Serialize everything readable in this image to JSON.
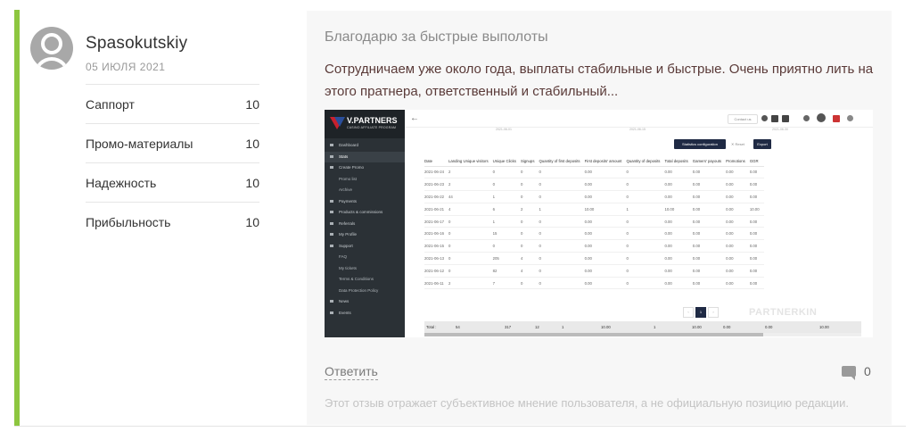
{
  "review": {
    "author": "Spasokutskiy",
    "date": "05 ИЮЛЯ 2021",
    "ratings": [
      {
        "label": "Саппорт",
        "value": "10"
      },
      {
        "label": "Промо-материалы",
        "value": "10"
      },
      {
        "label": "Надежность",
        "value": "10"
      },
      {
        "label": "Прибыльность",
        "value": "10"
      }
    ],
    "title": "Благодарю за быстрые выполоты",
    "body": "Сотрудничаем уже около года, выплаты стабильные и быстрые. Очень приятно лить на этого пратнера, ответственный и стабильный...",
    "reply_label": "Ответить",
    "comment_count": "0",
    "disclaimer": "Этот отзыв отражает субъективное мнение пользователя, а не официальную позицию редакции."
  },
  "screenshot": {
    "brand": "V.PARTNERS",
    "brand_sub": "CASINO AFFILIATE PROGRAM",
    "menu": [
      {
        "label": "Dashboard",
        "type": "item"
      },
      {
        "label": "Stats",
        "type": "active"
      },
      {
        "label": "Create Promo",
        "type": "item"
      },
      {
        "label": "Promo list",
        "type": "sub"
      },
      {
        "label": "Archive",
        "type": "sub"
      },
      {
        "label": "Payments",
        "type": "item"
      },
      {
        "label": "Products & commissions",
        "type": "item"
      },
      {
        "label": "Referrals",
        "type": "item"
      },
      {
        "label": "My Profile",
        "type": "item"
      },
      {
        "label": "Support",
        "type": "item"
      },
      {
        "label": "FAQ",
        "type": "sub"
      },
      {
        "label": "My tickets",
        "type": "sub"
      },
      {
        "label": "Terms & Conditions",
        "type": "sub"
      },
      {
        "label": "Data Protection Policy",
        "type": "sub"
      },
      {
        "label": "News",
        "type": "item"
      },
      {
        "label": "Events",
        "type": "item"
      }
    ],
    "back_glyph": "←",
    "contact_label": "Contact us",
    "stats_config_label": "Statistics configuration",
    "reset_label": "✕ Reset",
    "export_label": "Export",
    "range_dates": [
      "2021-06-01",
      "2021-06-15",
      "2021-06-30"
    ],
    "columns": [
      "Date",
      "Landing Unique visitors",
      "Unique Clicks",
      "Signups",
      "Quantity of first deposits",
      "First deposits' amount",
      "Quantity of deposits",
      "Total deposits",
      "Gamers' payouts",
      "Promotions",
      "GGR"
    ],
    "rows": [
      [
        "2021-06-24",
        "2",
        "0",
        "0",
        "0",
        "0.00",
        "0",
        "0.00",
        "0.00",
        "0.00",
        "0.00"
      ],
      [
        "2021-06-23",
        "2",
        "0",
        "0",
        "0",
        "0.00",
        "0",
        "0.00",
        "0.00",
        "0.00",
        "0.00"
      ],
      [
        "2021-06-22",
        "44",
        "1",
        "0",
        "0",
        "0.00",
        "0",
        "0.00",
        "0.00",
        "0.00",
        "0.00"
      ],
      [
        "2021-06-21",
        "4",
        "6",
        "2",
        "1",
        "10.00",
        "1",
        "10.00",
        "0.00",
        "0.00",
        "10.00"
      ],
      [
        "2021-06-17",
        "0",
        "1",
        "0",
        "0",
        "0.00",
        "0",
        "0.00",
        "0.00",
        "0.00",
        "0.00"
      ],
      [
        "2021-06-16",
        "0",
        "15",
        "0",
        "0",
        "0.00",
        "0",
        "0.00",
        "0.00",
        "0.00",
        "0.00"
      ],
      [
        "2021-06-15",
        "0",
        "0",
        "0",
        "0",
        "0.00",
        "0",
        "0.00",
        "0.00",
        "0.00",
        "0.00"
      ],
      [
        "2021-06-13",
        "0",
        "205",
        "4",
        "0",
        "0.00",
        "0",
        "0.00",
        "0.00",
        "0.00",
        "0.00"
      ],
      [
        "2021-06-12",
        "0",
        "82",
        "4",
        "0",
        "0.00",
        "0",
        "0.00",
        "0.00",
        "0.00",
        "0.00"
      ],
      [
        "2021-06-11",
        "2",
        "7",
        "0",
        "0",
        "0.00",
        "0",
        "0.00",
        "0.00",
        "0.00",
        "0.00"
      ]
    ],
    "pager": [
      "‹",
      "1",
      "›"
    ],
    "watermark": "PARTNERKIN",
    "totals": [
      "Total :",
      "54",
      "317",
      "12",
      "1",
      "10.00",
      "1",
      "10.00",
      "0.00",
      "0.00",
      "10.00"
    ]
  },
  "colors": {
    "accent": "#8dc63f",
    "card_bg": "#f7f7f7",
    "body_text": "#5a3a38"
  }
}
